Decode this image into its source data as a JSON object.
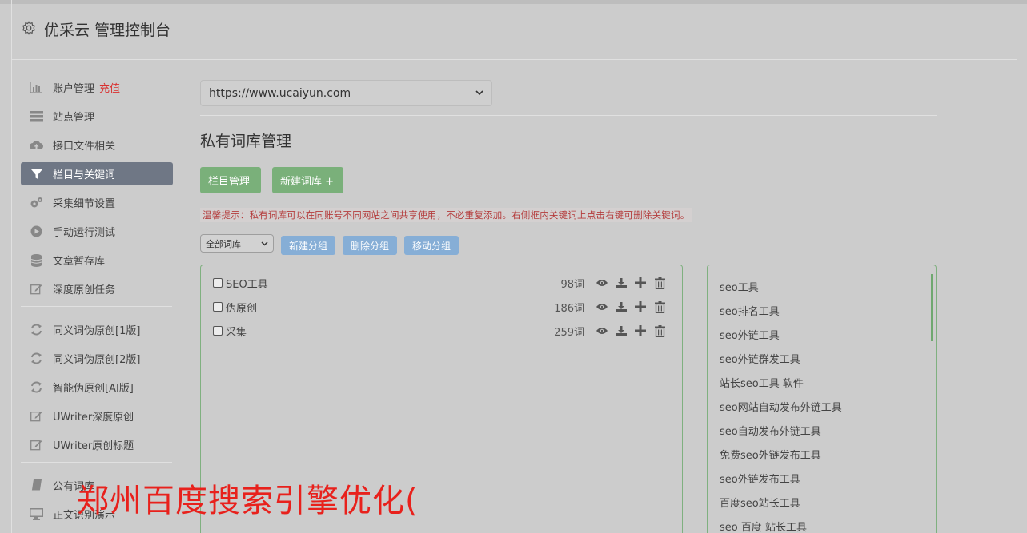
{
  "header": {
    "title": "优采云 管理控制台"
  },
  "sidebar": {
    "items": [
      {
        "label": "账户管理",
        "badge": "充值",
        "icon": "bar-chart-icon"
      },
      {
        "label": "站点管理",
        "icon": "server-icon"
      },
      {
        "label": "接口文件相关",
        "icon": "cloud-upload-icon"
      },
      {
        "label": "栏目与关键词",
        "icon": "filter-icon",
        "active": true
      },
      {
        "label": "采集细节设置",
        "icon": "cogs-icon"
      },
      {
        "label": "手动运行测试",
        "icon": "play-circle-icon"
      },
      {
        "label": "文章暂存库",
        "icon": "database-icon"
      },
      {
        "label": "深度原创任务",
        "icon": "edit-icon"
      }
    ],
    "items2": [
      {
        "label": "同义词伪原创[1版]",
        "icon": "refresh-icon"
      },
      {
        "label": "同义词伪原创[2版]",
        "icon": "refresh-icon"
      },
      {
        "label": "智能伪原创[AI版]",
        "icon": "refresh-icon"
      },
      {
        "label": "UWriter深度原创",
        "icon": "edit-icon"
      },
      {
        "label": "UWriter原创标题",
        "icon": "edit-icon"
      }
    ],
    "items3": [
      {
        "label": "公有词库",
        "icon": "book-icon"
      },
      {
        "label": "正文识别演示",
        "icon": "desktop-icon"
      }
    ]
  },
  "main": {
    "site_select": "https://www.ucaiyun.com",
    "section_title": "私有词库管理",
    "btn_column": "栏目管理",
    "btn_new_lib": "新建词库 +",
    "tip": "温馨提示：私有词库可以在同账号不同网站之间共享使用，不必重复添加。右侧框内关键词上点击右键可删除关键词。",
    "group_select": "全部词库",
    "btn_new_group": "新建分组",
    "btn_delete_group": "删除分组",
    "btn_move_group": "移动分组",
    "libraries": [
      {
        "name": "SEO工具",
        "count": "98词"
      },
      {
        "name": "伪原创",
        "count": "186词"
      },
      {
        "name": "采集",
        "count": "259词"
      }
    ],
    "keywords": [
      "seo工具",
      "seo排名工具",
      "seo外链工具",
      "seo外链群发工具",
      "站长seo工具 软件",
      "seo网站自动发布外链工具",
      "seo自动发布外链工具",
      "免费seo外链发布工具",
      "seo外链发布工具",
      "百度seo站长工具",
      "seo 百度 站长工具"
    ]
  },
  "overlay": "郑州百度搜索引擎优化("
}
